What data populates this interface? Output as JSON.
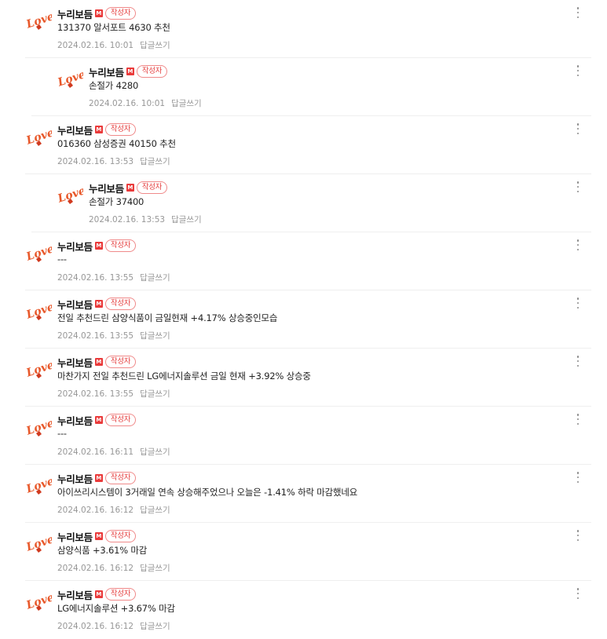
{
  "accent_color": "#e53e3e",
  "comments": [
    {
      "nickname": "누리보듬",
      "manager_icon": "M",
      "author_badge": "작성자",
      "text": "131370 알서포트 4630 추천",
      "date": "2024.02.16. 10:01",
      "reply_label": "답글쓰기",
      "more_icon": "vertical-dots-icon",
      "is_reply": false
    },
    {
      "nickname": "누리보듬",
      "manager_icon": "M",
      "author_badge": "작성자",
      "text": "손절가 4280",
      "date": "2024.02.16. 10:01",
      "reply_label": "답글쓰기",
      "more_icon": "vertical-dots-icon",
      "is_reply": true
    },
    {
      "nickname": "누리보듬",
      "manager_icon": "M",
      "author_badge": "작성자",
      "text": "016360 삼성증권 40150 추천",
      "date": "2024.02.16. 13:53",
      "reply_label": "답글쓰기",
      "more_icon": "vertical-dots-icon",
      "is_reply": false
    },
    {
      "nickname": "누리보듬",
      "manager_icon": "M",
      "author_badge": "작성자",
      "text": "손절가 37400",
      "date": "2024.02.16. 13:53",
      "reply_label": "답글쓰기",
      "more_icon": "vertical-dots-icon",
      "is_reply": true
    },
    {
      "nickname": "누리보듬",
      "manager_icon": "M",
      "author_badge": "작성자",
      "text": "---",
      "date": "2024.02.16. 13:55",
      "reply_label": "답글쓰기",
      "more_icon": "vertical-dots-icon",
      "is_reply": false
    },
    {
      "nickname": "누리보듬",
      "manager_icon": "M",
      "author_badge": "작성자",
      "text": "전일 추천드린 삼양식품이 금일현재 +4.17% 상승중인모습",
      "date": "2024.02.16. 13:55",
      "reply_label": "답글쓰기",
      "more_icon": "vertical-dots-icon",
      "is_reply": false
    },
    {
      "nickname": "누리보듬",
      "manager_icon": "M",
      "author_badge": "작성자",
      "text": "마찬가지 전일 추천드린 LG에너지솔루션 금일 현재 +3.92% 상승중",
      "date": "2024.02.16. 13:55",
      "reply_label": "답글쓰기",
      "more_icon": "vertical-dots-icon",
      "is_reply": false
    },
    {
      "nickname": "누리보듬",
      "manager_icon": "M",
      "author_badge": "작성자",
      "text": "---",
      "date": "2024.02.16. 16:11",
      "reply_label": "답글쓰기",
      "more_icon": "vertical-dots-icon",
      "is_reply": false
    },
    {
      "nickname": "누리보듬",
      "manager_icon": "M",
      "author_badge": "작성자",
      "text": "아이쓰리시스템이 3거래일 연속 상승해주었으나 오늘은 -1.41% 하락 마감했네요",
      "date": "2024.02.16. 16:12",
      "reply_label": "답글쓰기",
      "more_icon": "vertical-dots-icon",
      "is_reply": false
    },
    {
      "nickname": "누리보듬",
      "manager_icon": "M",
      "author_badge": "작성자",
      "text": "삼양식품 +3.61% 마감",
      "date": "2024.02.16. 16:12",
      "reply_label": "답글쓰기",
      "more_icon": "vertical-dots-icon",
      "is_reply": false
    },
    {
      "nickname": "누리보듬",
      "manager_icon": "M",
      "author_badge": "작성자",
      "text": "LG에너지솔루션 +3.67% 마감",
      "date": "2024.02.16. 16:12",
      "reply_label": "답글쓰기",
      "more_icon": "vertical-dots-icon",
      "is_reply": false
    }
  ]
}
